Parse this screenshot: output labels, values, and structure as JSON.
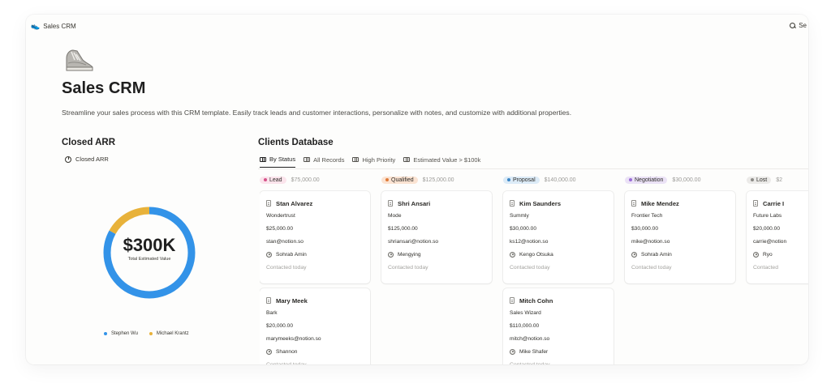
{
  "breadcrumb": {
    "title": "Sales CRM"
  },
  "topbar": {
    "search_label": "Se"
  },
  "page": {
    "title": "Sales CRM",
    "description": "Streamline your sales process with this CRM template. Easily track leads and customer interactions, personalize with notes, and customize with additional properties."
  },
  "closed_arr": {
    "heading": "Closed ARR",
    "view_label": "Closed ARR",
    "donut_value": "$300K",
    "donut_caption": "Total Estimated Value",
    "legend": [
      {
        "label": "Stephen Wu",
        "color": "#3393e8"
      },
      {
        "label": "Michael Krantz",
        "color": "#e8b23a"
      }
    ]
  },
  "chart_data": {
    "type": "pie",
    "title": "",
    "center_label": "$300K",
    "center_caption": "Total Estimated Value",
    "slices": [
      {
        "name": "Stephen Wu",
        "value": 0.83,
        "color": "#3393e8"
      },
      {
        "name": "Michael Krantz",
        "value": 0.17,
        "color": "#e8b23a"
      }
    ],
    "legend_position": "bottom"
  },
  "clients": {
    "heading": "Clients Database",
    "tabs": [
      {
        "label": "By Status",
        "active": true
      },
      {
        "label": "All Records",
        "active": false
      },
      {
        "label": "High Priority",
        "active": false
      },
      {
        "label": "Estimated Value > $100k",
        "active": false
      }
    ],
    "columns": [
      {
        "status": "Lead",
        "pill_bg": "#fbe4ec",
        "dot": "#d6538a",
        "sum": "$75,000.00",
        "cards": [
          {
            "name": "Stan Alvarez",
            "company": "Wondertrust",
            "value": "$25,000.00",
            "email": "stan@notion.so",
            "owner": "Sohrab Amin",
            "last_contact": "Contacted today"
          },
          {
            "name": "Mary Meek",
            "company": "Bark",
            "value": "$20,000.00",
            "email": "marymeeks@notion.so",
            "owner": "Shannon",
            "last_contact": "Contacted today"
          }
        ]
      },
      {
        "status": "Qualified",
        "pill_bg": "#fbe3d2",
        "dot": "#e07b39",
        "sum": "$125,000.00",
        "cards": [
          {
            "name": "Shri Ansari",
            "company": "Mode",
            "value": "$125,000.00",
            "email": "shriansari@notion.so",
            "owner": "Mengying",
            "last_contact": "Contacted today"
          }
        ]
      },
      {
        "status": "Proposal",
        "pill_bg": "#dcebf7",
        "dot": "#3d87c7",
        "sum": "$140,000.00",
        "cards": [
          {
            "name": "Kim Saunders",
            "company": "Summly",
            "value": "$30,000.00",
            "email": "ks12@notion.so",
            "owner": "Kengo Otsuka",
            "last_contact": "Contacted today"
          },
          {
            "name": "Mitch Cohn",
            "company": "Sales Wizard",
            "value": "$110,000.00",
            "email": "mitch@notion.so",
            "owner": "Mike Shafer",
            "last_contact": "Contacted today"
          }
        ]
      },
      {
        "status": "Negotiation",
        "pill_bg": "#ebe2f6",
        "dot": "#9a6dd7",
        "sum": "$30,000.00",
        "cards": [
          {
            "name": "Mike Mendez",
            "company": "Frontier Tech",
            "value": "$30,000.00",
            "email": "mike@notion.so",
            "owner": "Sohrab Amin",
            "last_contact": "Contacted today"
          }
        ]
      },
      {
        "status": "Lost",
        "pill_bg": "#ebeae8",
        "dot": "#8c8b87",
        "sum": "$2",
        "cards": [
          {
            "name": "Carrie I",
            "company": "Future Labs",
            "value": "$20,000.00",
            "email": "carrie@notion",
            "owner": "Ryo",
            "last_contact": "Contacted"
          }
        ]
      }
    ]
  }
}
